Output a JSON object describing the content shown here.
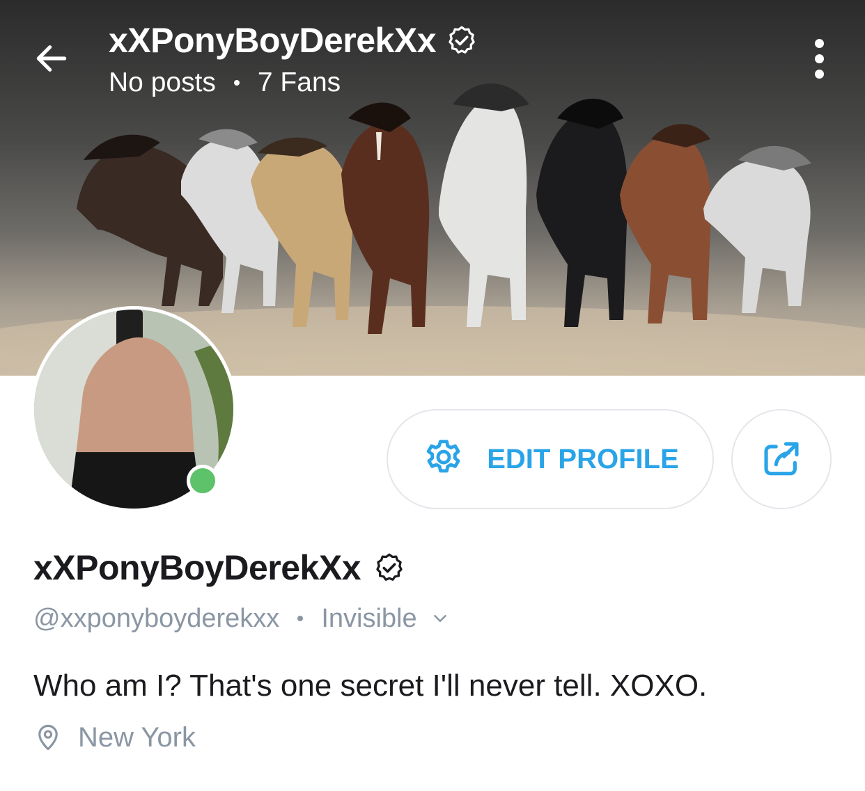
{
  "header": {
    "title": "xXPonyBoyDerekXx",
    "posts_label": "No posts",
    "fans_label": "7 Fans"
  },
  "actions": {
    "edit_profile_label": "EDIT PROFILE"
  },
  "profile": {
    "display_name": "xXPonyBoyDerekXx",
    "handle": "@xxponyboyderekxx",
    "status": "Invisible",
    "bio": "Who am I? That's one secret I'll never tell. XOXO.",
    "location": "New York",
    "online": true
  },
  "icons": {
    "back": "arrow-left-icon",
    "verified": "verified-badge-icon",
    "menu": "more-vertical-icon",
    "edit": "gear-icon",
    "share": "share-icon",
    "status_toggle": "chevron-down-icon",
    "location": "map-pin-icon"
  },
  "colors": {
    "accent": "#2aa4e8",
    "online": "#5ec26a",
    "muted_text": "#8a96a3",
    "primary_text": "#1b1b1f",
    "button_border": "#e3e6ea"
  }
}
